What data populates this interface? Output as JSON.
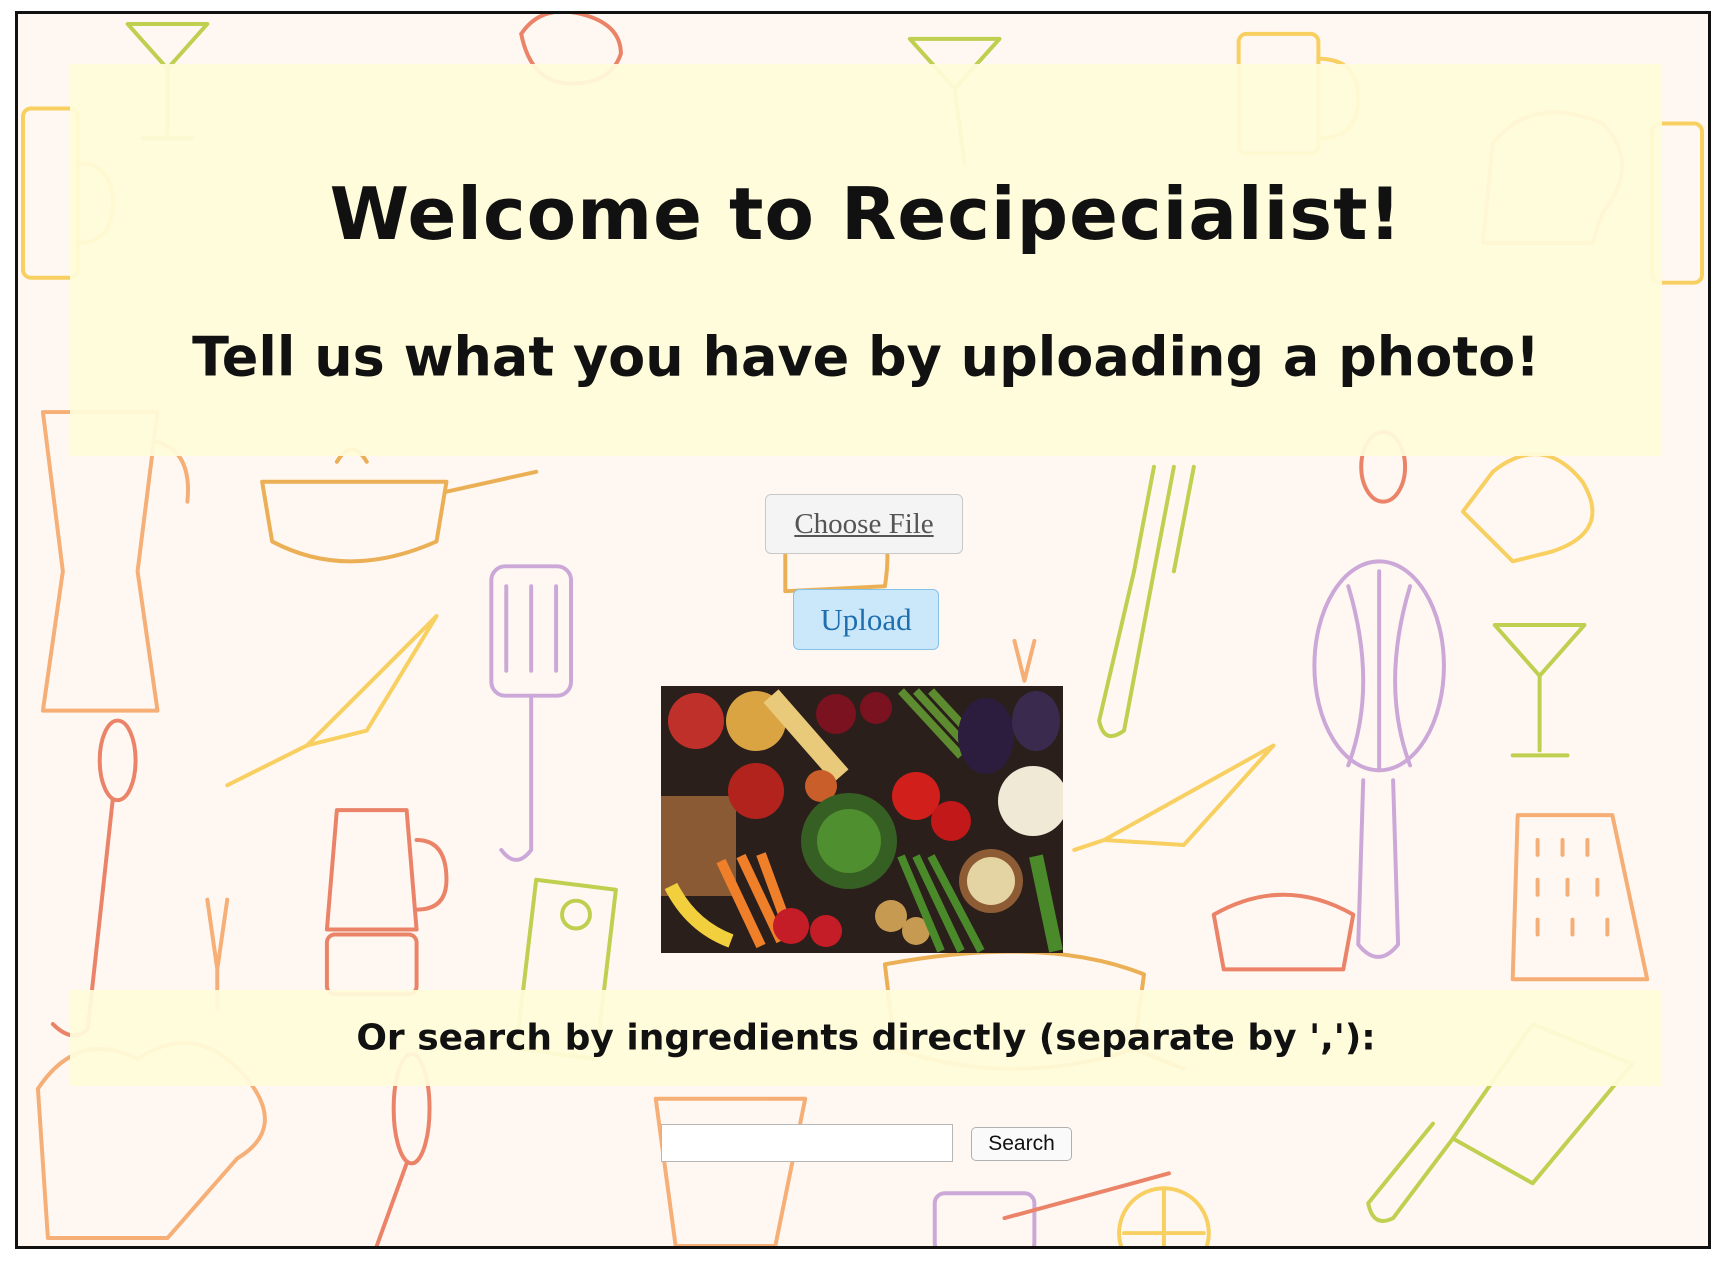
{
  "header": {
    "title": "Welcome to Recipecialist!",
    "subtitle": "Tell us what you have by uploading a photo!"
  },
  "upload_form": {
    "choose_file_label": "Choose File",
    "upload_label": "Upload"
  },
  "search": {
    "prompt": "Or search by ingredients directly (separate by ','):",
    "input_value": "",
    "button_label": "Search"
  },
  "background": {
    "doodle_colors": [
      "#f7c948",
      "#f4a261",
      "#e76f51",
      "#b5c934",
      "#c39bd3",
      "#e8a33a"
    ],
    "doodle_icons": [
      "cocktail-glass",
      "beer-mug",
      "cooking-pot",
      "spatula",
      "whisk",
      "knife",
      "fork",
      "blender",
      "grater",
      "cleaver",
      "moka-pot",
      "chef-hat"
    ]
  },
  "food_image": {
    "icon": "vegetables-photo"
  }
}
